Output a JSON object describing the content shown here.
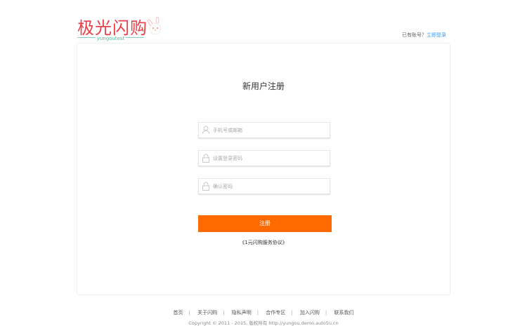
{
  "logo": {
    "text": "极光闪购",
    "subtitle": "yungoutest"
  },
  "header": {
    "has_account": "已有账号？",
    "login_link": "立即登录"
  },
  "form": {
    "title": "新用户注册",
    "phone_placeholder": "手机号或邮箱",
    "password_placeholder": "设置登录密码",
    "confirm_placeholder": "确认密码",
    "submit": "注册",
    "agreement": "《1元闪购服务协议》"
  },
  "footer": {
    "links": [
      "首页",
      "关于闪购",
      "隐私声明",
      "合作专区",
      "加入闪购",
      "联系我们"
    ],
    "copyright": "Copyright © 2011 - 2015, 版权所有 http://yungou.demo.auto5u.cn"
  },
  "colors": {
    "accent": "#ff6a00",
    "logo": "#e8404a",
    "link": "#3399ff"
  }
}
